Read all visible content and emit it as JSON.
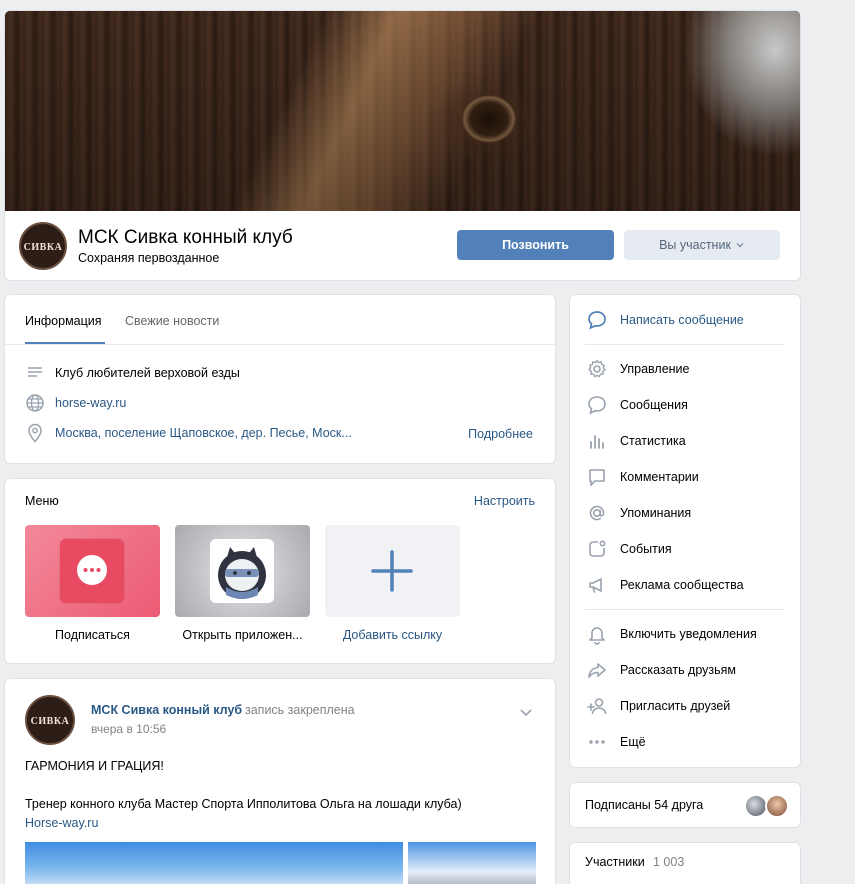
{
  "group": {
    "name": "МСК Сивка конный клуб",
    "status": "Сохраняя первозданное",
    "logo_text": "СИВКА",
    "call_button": "Позвонить",
    "member_button": "Вы участник"
  },
  "info": {
    "tabs": [
      "Информация",
      "Свежие новости"
    ],
    "description": "Клуб любителей верховой езды",
    "website": "horse-way.ru",
    "address": "Москва, поселение Щаповское, дер. Песье, Моск...",
    "more": "Подробнее"
  },
  "menu": {
    "title": "Меню",
    "configure": "Настроить",
    "items": [
      {
        "label": "Подписаться"
      },
      {
        "label": "Открыть приложен..."
      },
      {
        "label": "Добавить ссылку"
      }
    ]
  },
  "post": {
    "author": "МСК Сивка конный клуб",
    "pinned": "запись закреплена",
    "time": "вчера в 10:56",
    "line1": "ГАРМОНИЯ И ГРАЦИЯ!",
    "line2": "Тренер конного клуба Мастер Спорта Ипполитова Ольга на лошади клуба)",
    "link": "Horse-way.ru"
  },
  "actions": {
    "primary": "Написать сообщение",
    "manage": [
      "Управление",
      "Сообщения",
      "Статистика",
      "Комментарии",
      "Упоминания",
      "События",
      "Реклама сообщества"
    ],
    "social": [
      "Включить уведомления",
      "Рассказать друзьям",
      "Пригласить друзей",
      "Ещё"
    ]
  },
  "friends": {
    "text": "Подписаны 54 друга"
  },
  "members": {
    "label": "Участники",
    "count": "1 003"
  },
  "colors": {
    "accent": "#5181b8",
    "link": "#2a5885",
    "background": "#edeef0",
    "icon": "#99a2ad",
    "subscribe_tile": "#f06d7e"
  }
}
